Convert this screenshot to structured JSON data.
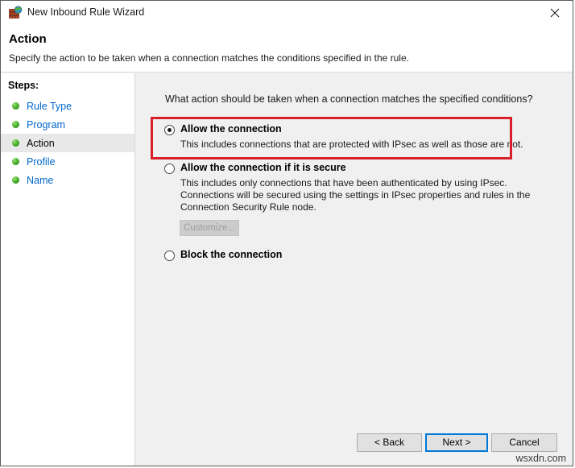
{
  "window": {
    "title": "New Inbound Rule Wizard",
    "icon": "firewall-globe-icon",
    "close_label": "✕"
  },
  "header": {
    "title": "Action",
    "subtitle": "Specify the action to be taken when a connection matches the conditions specified in the rule."
  },
  "sidebar": {
    "header": "Steps:",
    "items": [
      {
        "label": "Rule Type",
        "current": false
      },
      {
        "label": "Program",
        "current": false
      },
      {
        "label": "Action",
        "current": true
      },
      {
        "label": "Profile",
        "current": false
      },
      {
        "label": "Name",
        "current": false
      }
    ]
  },
  "main": {
    "question": "What action should be taken when a connection matches the specified conditions?",
    "options": [
      {
        "title": "Allow the connection",
        "description": "This includes connections that are protected with IPsec as well as those are not.",
        "selected": true
      },
      {
        "title": "Allow the connection if it is secure",
        "description": "This includes only connections that have been authenticated by using IPsec.  Connections will be secured using the settings in IPsec properties and rules in the Connection Security Rule node.",
        "selected": false,
        "customize_label": "Customize..."
      },
      {
        "title": "Block the connection",
        "description": "",
        "selected": false
      }
    ],
    "highlight_color": "#d81f2a"
  },
  "footer": {
    "back_label": "< Back",
    "next_label": "Next >",
    "cancel_label": "Cancel"
  },
  "watermark": "wsxdn.com"
}
